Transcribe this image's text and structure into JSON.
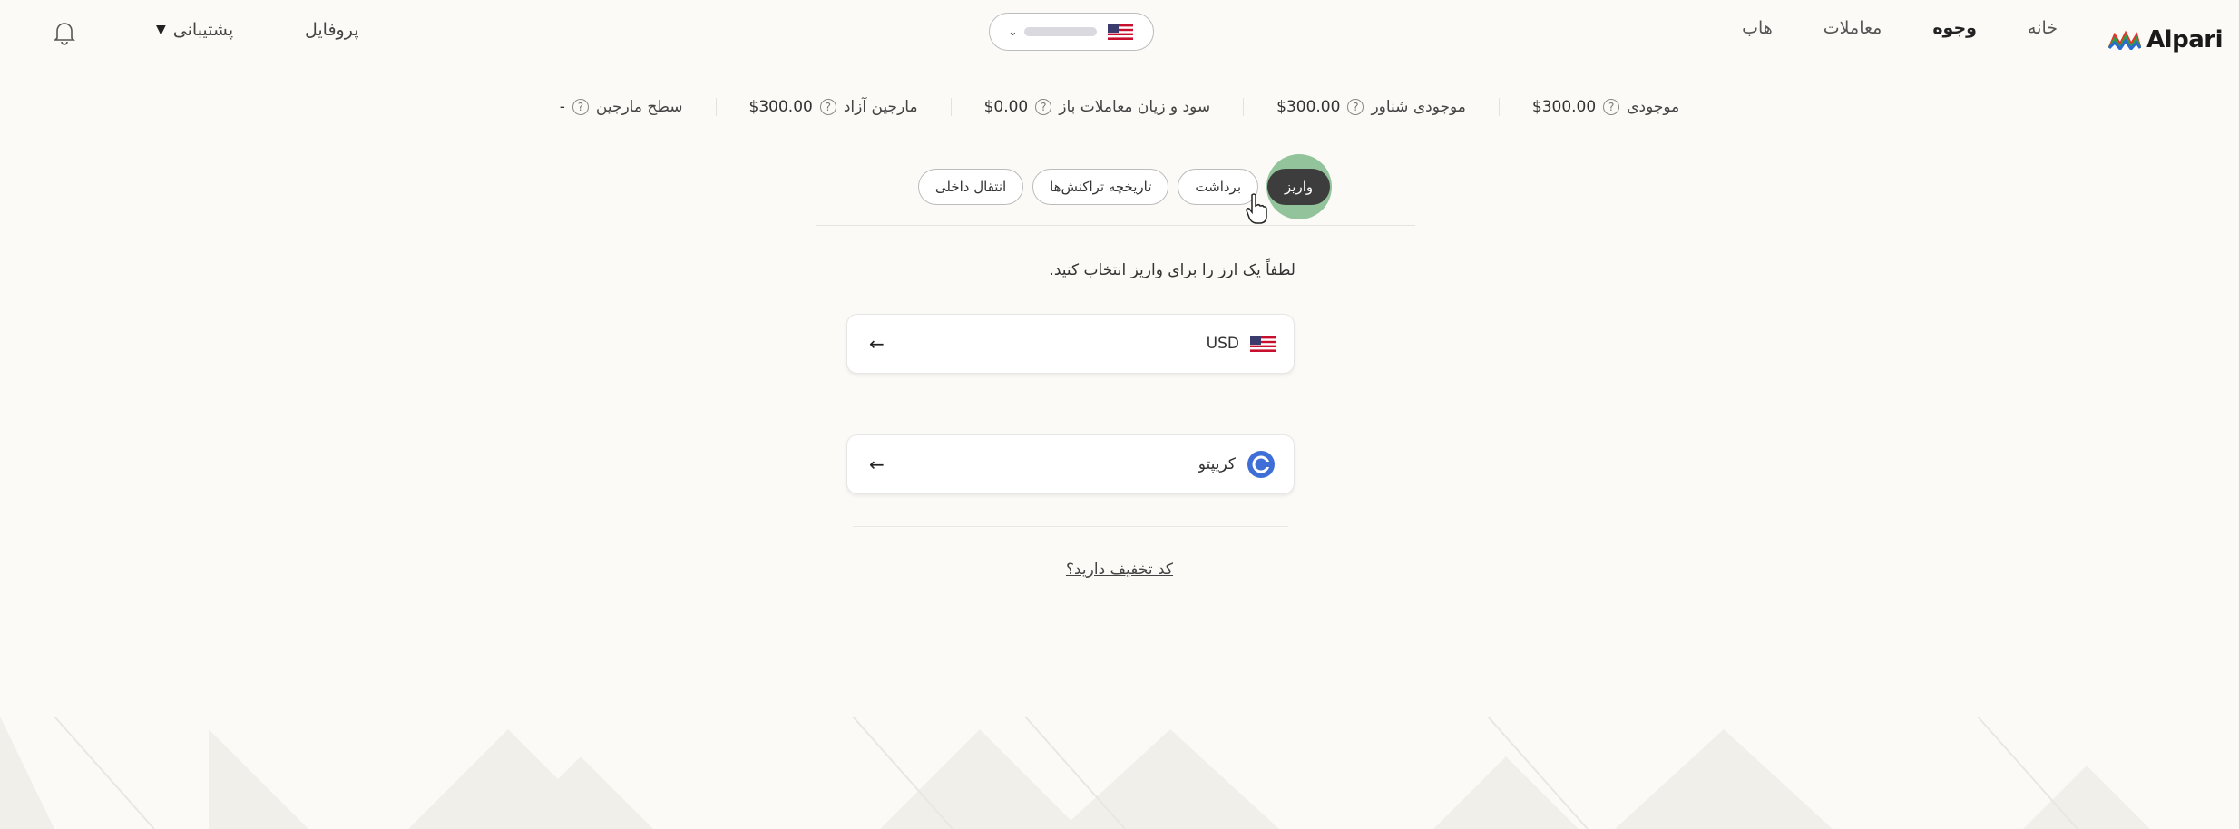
{
  "header": {
    "logo_text": "Alpari",
    "nav": [
      {
        "label": "خانه",
        "active": false
      },
      {
        "label": "وجوه",
        "active": true
      },
      {
        "label": "معاملات",
        "active": false
      },
      {
        "label": "هاب",
        "active": false
      }
    ],
    "profile_label": "پروفایل",
    "support_label": "پشتیبانی"
  },
  "balances": [
    {
      "label": "موجودی",
      "value": "$300.00"
    },
    {
      "label": "موجودی شناور",
      "value": "$300.00"
    },
    {
      "label": "سود و زیان معاملات باز",
      "value": "$0.00"
    },
    {
      "label": "مارجین آزاد",
      "value": "$300.00"
    },
    {
      "label": "سطح مارجین",
      "value": "-"
    }
  ],
  "tabs": [
    {
      "label": "واریز",
      "active": true
    },
    {
      "label": "برداشت",
      "active": false
    },
    {
      "label": "تاریخچه تراکنش‌ها",
      "active": false
    },
    {
      "label": "انتقال داخلی",
      "active": false
    }
  ],
  "deposit": {
    "prompt": "لطفاً یک ارز را برای واریز انتخاب کنید.",
    "options": [
      {
        "label": "USD",
        "icon": "us-flag-icon"
      },
      {
        "label": "کریپتو",
        "icon": "crypto-coin-icon"
      }
    ],
    "promo_link": "کد تخفیف دارید؟"
  },
  "colors": {
    "background": "#fbfaf6",
    "active_tab": "#3d3d3d",
    "click_highlight": "#3c9650",
    "crypto_blue": "#3f6fd6"
  }
}
